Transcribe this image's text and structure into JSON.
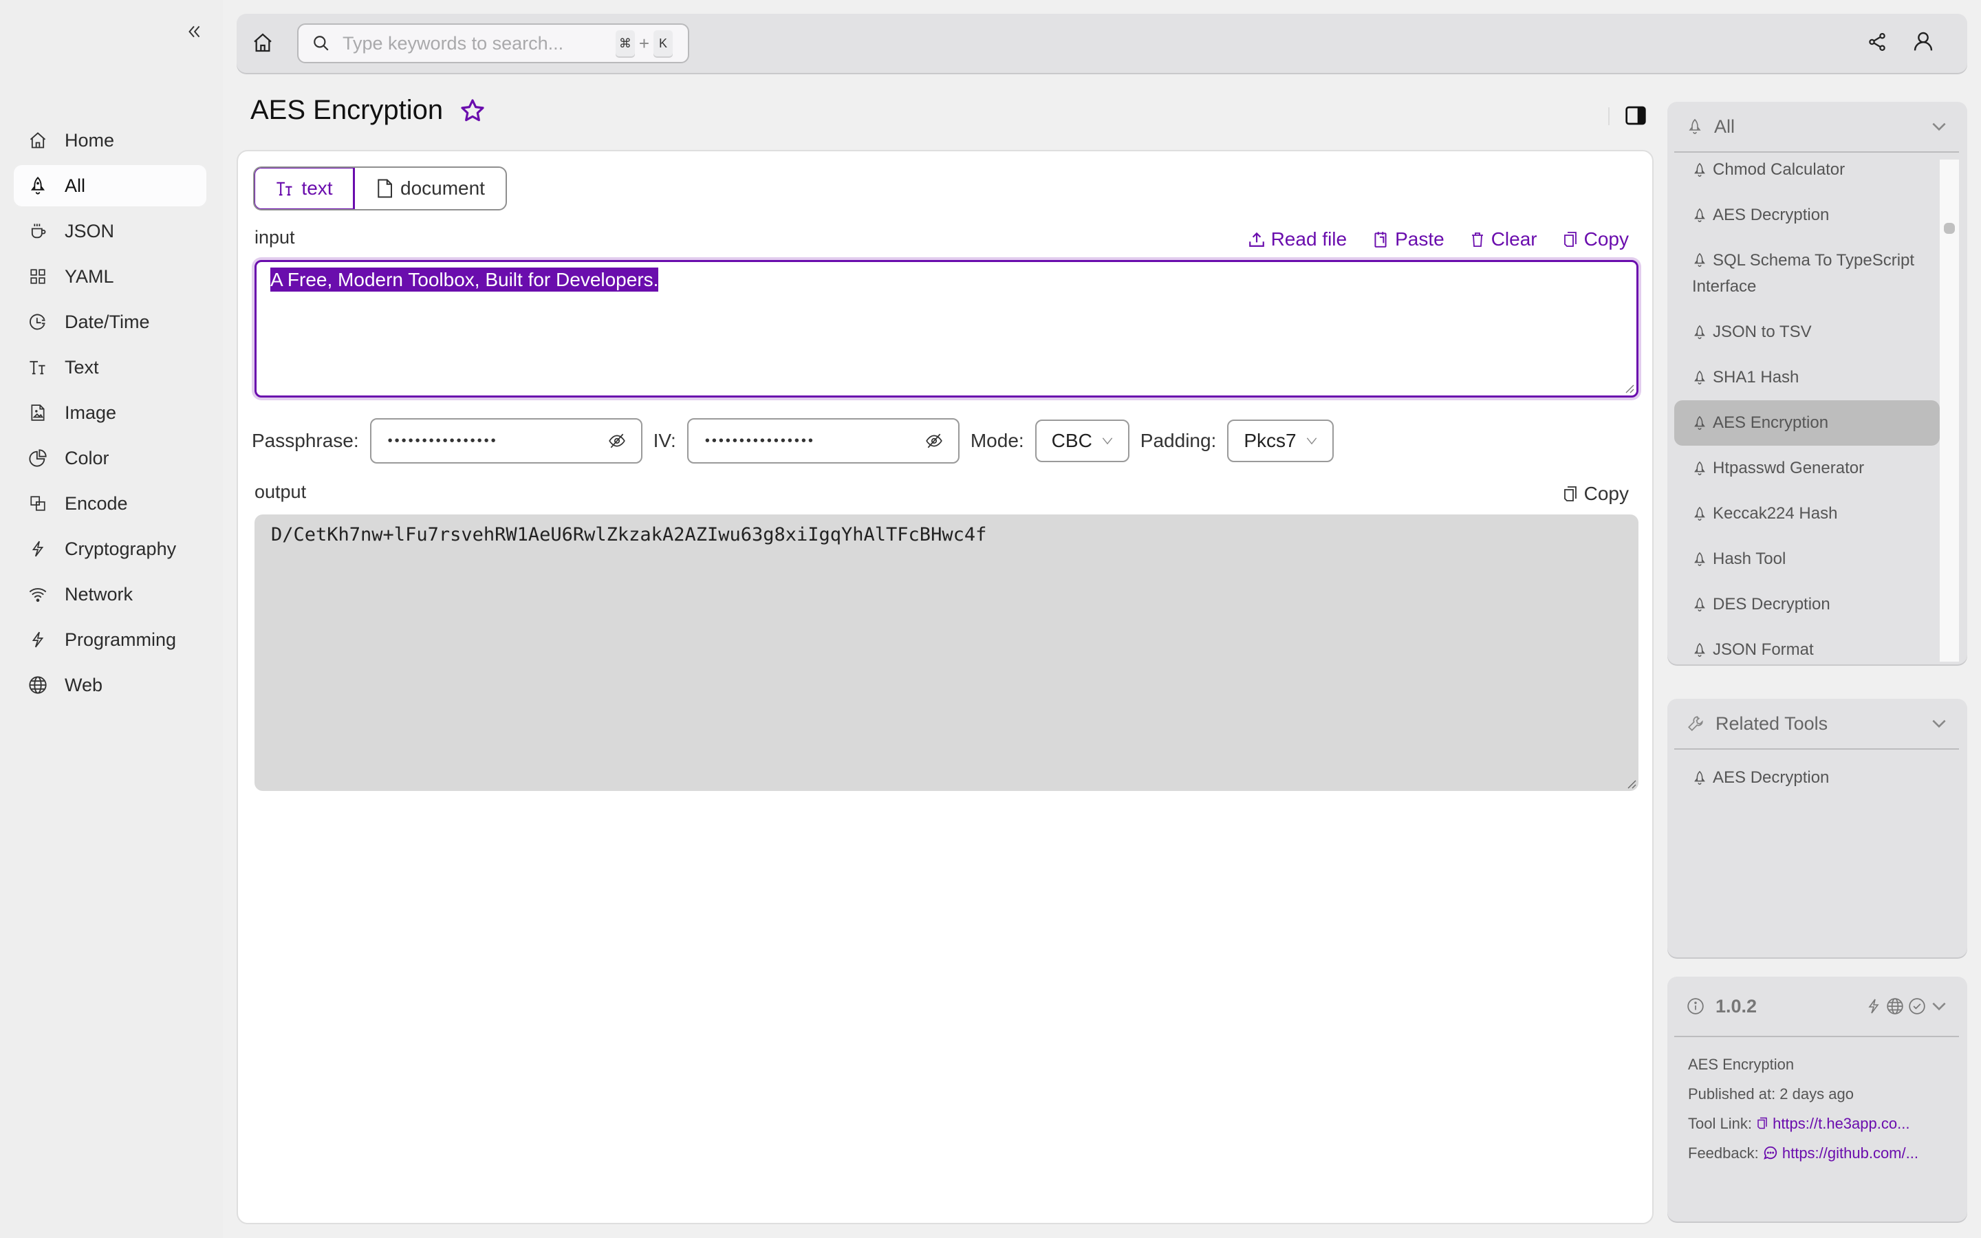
{
  "sidebar": {
    "collapse_icon": "double-chevron-left-icon",
    "items": [
      {
        "label": "Home",
        "icon": "home-icon",
        "active": false
      },
      {
        "label": "All",
        "icon": "rocket-icon",
        "active": true
      },
      {
        "label": "JSON",
        "icon": "coffee-cup-icon",
        "active": false
      },
      {
        "label": "YAML",
        "icon": "grid-icon",
        "active": false
      },
      {
        "label": "Date/Time",
        "icon": "clock-icon",
        "active": false
      },
      {
        "label": "Text",
        "icon": "text-type-icon",
        "active": false
      },
      {
        "label": "Image",
        "icon": "image-file-icon",
        "active": false
      },
      {
        "label": "Color",
        "icon": "pie-chart-icon",
        "active": false
      },
      {
        "label": "Encode",
        "icon": "overlap-squares-icon",
        "active": false
      },
      {
        "label": "Cryptography",
        "icon": "lightning-icon",
        "active": false
      },
      {
        "label": "Network",
        "icon": "wifi-icon",
        "active": false
      },
      {
        "label": "Programming",
        "icon": "lightning-icon",
        "active": false
      },
      {
        "label": "Web",
        "icon": "globe-icon",
        "active": false
      }
    ]
  },
  "topbar": {
    "search_placeholder": "Type keywords to search...",
    "search_value": "",
    "shortcut_mod": "⌘",
    "shortcut_plus": "+",
    "shortcut_key": "K"
  },
  "page": {
    "title": "AES Encryption",
    "favorited": false
  },
  "tabs": [
    {
      "label": "text",
      "icon": "text-type-icon",
      "active": true
    },
    {
      "label": "document",
      "icon": "file-icon",
      "active": false
    }
  ],
  "input": {
    "label": "input",
    "value": "A Free, Modern Toolbox, Built for Developers.",
    "actions": {
      "read_file": "Read file",
      "paste": "Paste",
      "clear": "Clear",
      "copy": "Copy"
    }
  },
  "params": {
    "passphrase_label": "Passphrase:",
    "passphrase_masked": "••••••••••••••••",
    "iv_label": "IV:",
    "iv_masked": "••••••••••••••••",
    "mode_label": "Mode:",
    "mode_value": "CBC",
    "padding_label": "Padding:",
    "padding_value": "Pkcs7"
  },
  "output": {
    "label": "output",
    "copy_label": "Copy",
    "value": "D/CetKh7nw+lFu7rsvehRW1AeU6RwlZkzakA2AZIwu63g8xiIgqYhAlTFcBHwc4f"
  },
  "right_panel": {
    "all": {
      "title": "All",
      "items": [
        {
          "label": "Chmod Calculator",
          "active": false
        },
        {
          "label": "AES Decryption",
          "active": false
        },
        {
          "label": "SQL Schema To TypeScript Interface",
          "active": false
        },
        {
          "label": "JSON to TSV",
          "active": false
        },
        {
          "label": "SHA1 Hash",
          "active": false
        },
        {
          "label": "AES Encryption",
          "active": true
        },
        {
          "label": "Htpasswd Generator",
          "active": false
        },
        {
          "label": "Keccak224 Hash",
          "active": false
        },
        {
          "label": "Hash Tool",
          "active": false
        },
        {
          "label": "DES Decryption",
          "active": false
        },
        {
          "label": "JSON Format",
          "active": false
        }
      ]
    },
    "related": {
      "title": "Related Tools",
      "items": [
        {
          "label": "AES Decryption"
        }
      ]
    },
    "info": {
      "version": "1.0.2",
      "tool_name": "AES Encryption",
      "published": "Published at: 2 days ago",
      "tool_link_label": "Tool Link:",
      "tool_link": "https://t.he3app.co...",
      "feedback_label": "Feedback:",
      "feedback_link": "https://github.com/..."
    }
  },
  "colors": {
    "accent": "#6a0dad",
    "background": "#f0f0f0",
    "panel": "#e2e2e4",
    "output_bg": "#d9d9d9"
  }
}
